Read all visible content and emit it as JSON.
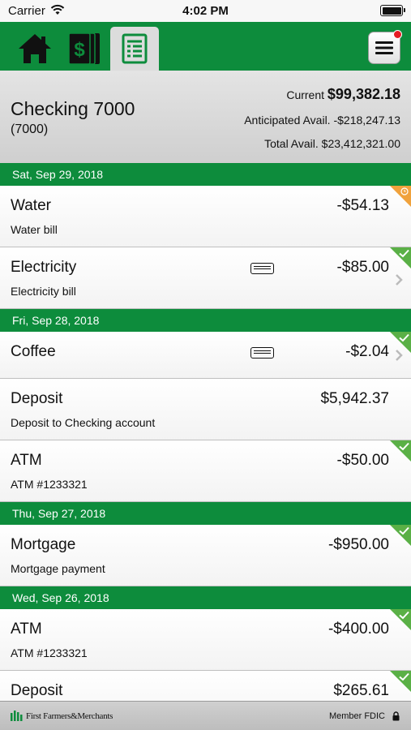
{
  "status_bar": {
    "carrier": "Carrier",
    "time": "4:02 PM"
  },
  "nav": {
    "tabs": [
      {
        "icon": "home-icon",
        "selected": false
      },
      {
        "icon": "money-icon",
        "selected": false
      },
      {
        "icon": "register-icon",
        "selected": true
      }
    ],
    "menu_icon": "hamburger-menu-icon",
    "menu_has_notification": true
  },
  "account": {
    "name": "Checking 7000",
    "number": "(7000)",
    "current_label": "Current ",
    "current_value": "$99,382.18",
    "anticipated_label": "Anticipated Avail. ",
    "anticipated_value": "-$218,247.13",
    "total_label": "Total Avail. ",
    "total_value": "$23,412,321.00"
  },
  "groups": [
    {
      "date": "Sat, Sep 29, 2018",
      "transactions": [
        {
          "title": "Water",
          "subtitle": "Water bill",
          "amount": "-$54.13",
          "status": "pending",
          "memo": false,
          "chevron": false
        },
        {
          "title": "Electricity",
          "subtitle": "Electricity bill",
          "amount": "-$85.00",
          "status": "cleared",
          "memo": true,
          "chevron": true
        }
      ]
    },
    {
      "date": "Fri, Sep 28, 2018",
      "transactions": [
        {
          "title": "Coffee",
          "subtitle": "",
          "amount": "-$2.04",
          "status": "cleared",
          "memo": true,
          "chevron": true
        },
        {
          "title": "Deposit",
          "subtitle": "Deposit to Checking account",
          "amount": "$5,942.37",
          "status": "",
          "memo": false,
          "chevron": false
        },
        {
          "title": "ATM",
          "subtitle": "ATM #1233321",
          "amount": "-$50.00",
          "status": "cleared",
          "memo": false,
          "chevron": false
        }
      ]
    },
    {
      "date": "Thu, Sep 27, 2018",
      "transactions": [
        {
          "title": "Mortgage",
          "subtitle": "Mortgage payment",
          "amount": "-$950.00",
          "status": "cleared",
          "memo": false,
          "chevron": false
        }
      ]
    },
    {
      "date": "Wed, Sep 26, 2018",
      "transactions": [
        {
          "title": "ATM",
          "subtitle": "ATM #1233321",
          "amount": "-$400.00",
          "status": "cleared",
          "memo": false,
          "chevron": false
        },
        {
          "title": "Deposit",
          "subtitle": "",
          "amount": "$265.61",
          "status": "cleared",
          "memo": false,
          "chevron": false
        }
      ]
    }
  ],
  "footer": {
    "bank_name": "First Farmers&Merchants",
    "fdic": "Member FDIC"
  },
  "colors": {
    "brand_green": "#0d8c3c",
    "cleared_green": "#5ab046",
    "pending_orange": "#f0a23c",
    "notification_red": "#e61c24"
  }
}
